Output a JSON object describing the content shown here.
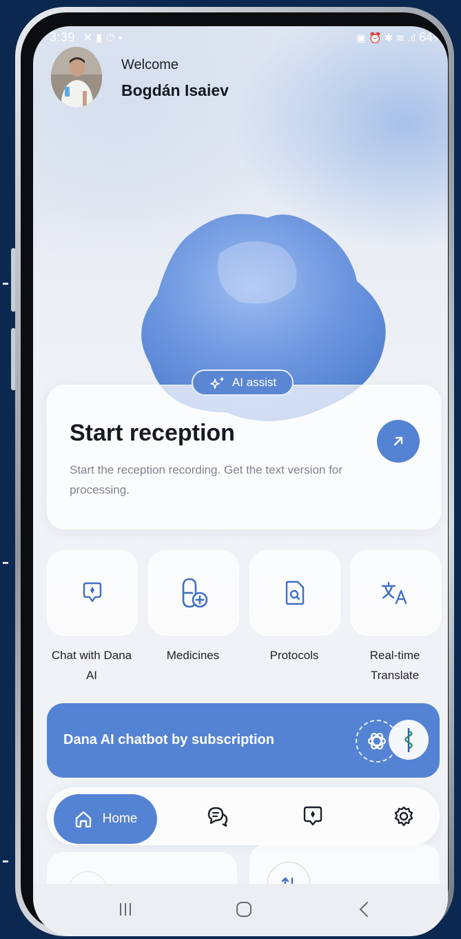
{
  "status_bar": {
    "time": "3:39",
    "battery": "64%"
  },
  "header": {
    "greeting": "Welcome",
    "user_name": "Bogdán Isaiev"
  },
  "hero": {
    "badge_label": "AI assist",
    "card_title": "Start reception",
    "card_description": "Start the reception recording. Get the text version for processing."
  },
  "quick_actions": [
    {
      "label": "Chat with Dana AI",
      "icon": "shield-chat-icon"
    },
    {
      "label": "Medicines",
      "icon": "pill-add-icon"
    },
    {
      "label": "Protocols",
      "icon": "document-search-icon"
    },
    {
      "label": "Real-time Translate",
      "icon": "translate-icon"
    }
  ],
  "promo": {
    "text": "Dana AI chatbot by subscription"
  },
  "bottom_nav": {
    "home_label": "Home"
  },
  "colors": {
    "accent": "#5583d3",
    "background_outer": "#0b2850",
    "text_primary": "#161a22",
    "text_secondary": "#7c8391"
  }
}
